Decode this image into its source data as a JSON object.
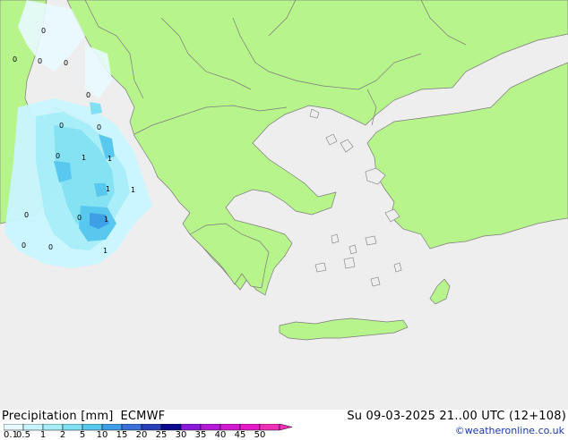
{
  "map": {
    "title": "Precipitation [mm]",
    "model": "ECMWF",
    "valid_time": "Su 09-03-2025 21..00 UTC (12+108)",
    "credit": "©weatheronline.co.uk",
    "sea_color": "#eeeeee",
    "land_color": "#b7f48c",
    "point_labels": [
      "0",
      "0",
      "0",
      "0",
      "0",
      "0",
      "0",
      "0",
      "0",
      "1",
      "1",
      "1",
      "1",
      "1",
      "0",
      "0",
      "0",
      "1"
    ]
  },
  "legend": {
    "ticks": [
      "0.1",
      "0.5",
      "1",
      "2",
      "5",
      "10",
      "15",
      "20",
      "25",
      "30",
      "35",
      "40",
      "45",
      "50"
    ],
    "colors": [
      "#e8faff",
      "#c8f4ff",
      "#a6edf8",
      "#80e0f2",
      "#59c8ee",
      "#3e9ee6",
      "#3a6fd8",
      "#2a3eb8",
      "#0b0a8c",
      "#8a18d8",
      "#b41ad8",
      "#d21ad0",
      "#e61ac8",
      "#ee30b8"
    ]
  }
}
